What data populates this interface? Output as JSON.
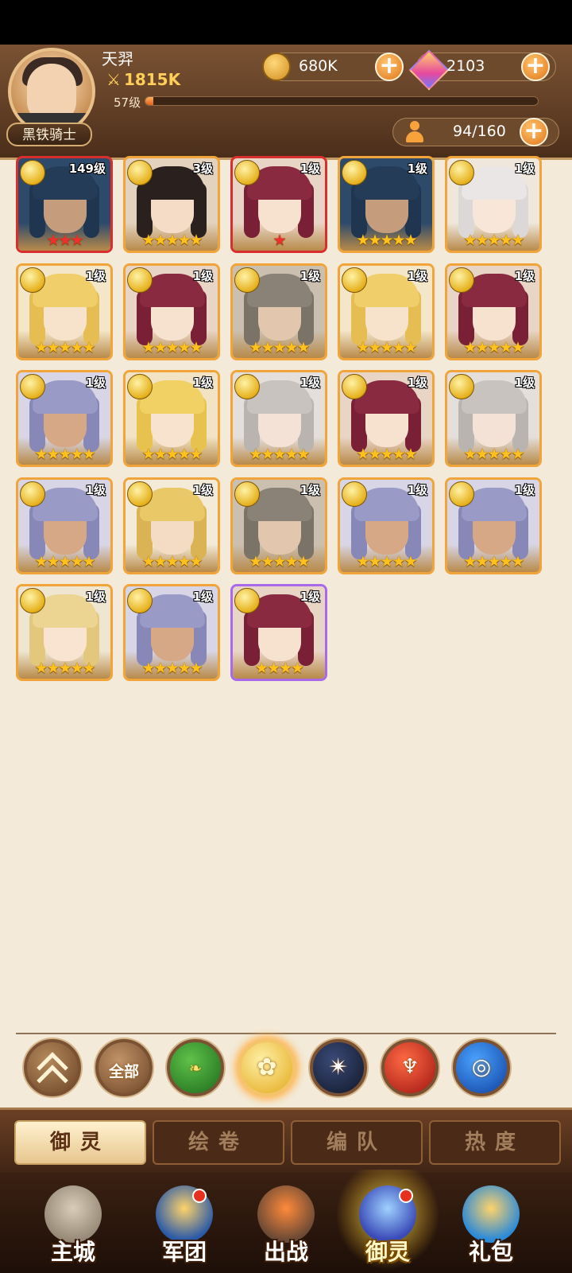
{
  "player": {
    "name": "天羿",
    "power": "1815K",
    "level": "57级",
    "xp_fraction": 0.02,
    "title": "黑铁骑士"
  },
  "resources": {
    "gold": "680K",
    "gems": "2103",
    "roster": "94/160"
  },
  "heroes": [
    {
      "level": "149级",
      "stars": 3,
      "frame": "red",
      "palette": "knight"
    },
    {
      "level": "3级",
      "stars": 5,
      "frame": "gold",
      "palette": "darkhair"
    },
    {
      "level": "1级",
      "stars": 1,
      "frame": "red",
      "palette": "redhair"
    },
    {
      "level": "1级",
      "stars": 5,
      "frame": "gold",
      "palette": "knight"
    },
    {
      "level": "1级",
      "stars": 5,
      "frame": "gold",
      "palette": "silverqueen"
    },
    {
      "level": "1级",
      "stars": 5,
      "frame": "gold",
      "palette": "blonde"
    },
    {
      "level": "1级",
      "stars": 5,
      "frame": "gold",
      "palette": "redhair"
    },
    {
      "level": "1级",
      "stars": 5,
      "frame": "gold",
      "palette": "greyman"
    },
    {
      "level": "1级",
      "stars": 5,
      "frame": "gold",
      "palette": "blonde"
    },
    {
      "level": "1级",
      "stars": 5,
      "frame": "gold",
      "palette": "redhair"
    },
    {
      "level": "1级",
      "stars": 5,
      "frame": "gold",
      "palette": "lavender"
    },
    {
      "level": "1级",
      "stars": 5,
      "frame": "gold",
      "palette": "blondeboy"
    },
    {
      "level": "1级",
      "stars": 5,
      "frame": "gold",
      "palette": "silver"
    },
    {
      "level": "1级",
      "stars": 5,
      "frame": "gold",
      "palette": "redhair"
    },
    {
      "level": "1级",
      "stars": 5,
      "frame": "gold",
      "palette": "silver"
    },
    {
      "level": "1级",
      "stars": 5,
      "frame": "gold",
      "palette": "lavender"
    },
    {
      "level": "1级",
      "stars": 5,
      "frame": "gold",
      "palette": "blondespike"
    },
    {
      "level": "1级",
      "stars": 5,
      "frame": "gold",
      "palette": "greyman"
    },
    {
      "level": "1级",
      "stars": 5,
      "frame": "gold",
      "palette": "lavender"
    },
    {
      "level": "1级",
      "stars": 5,
      "frame": "gold",
      "palette": "lavender"
    },
    {
      "level": "1级",
      "stars": 5,
      "frame": "gold",
      "palette": "crowned"
    },
    {
      "level": "1级",
      "stars": 5,
      "frame": "gold",
      "palette": "lavender"
    },
    {
      "level": "1级",
      "stars": 4,
      "frame": "purple",
      "palette": "redhair"
    }
  ],
  "filters": {
    "collapse_icon": "chevron-up-icon",
    "all_label": "全部",
    "factions": [
      "leaf-faction-icon",
      "rose-faction-icon",
      "star-faction-icon",
      "phoenix-faction-icon",
      "wave-faction-icon"
    ]
  },
  "subtabs": [
    "御灵",
    "绘卷",
    "编队",
    "热度"
  ],
  "nav": [
    {
      "label": "主城",
      "icon": "castle-icon"
    },
    {
      "label": "军团",
      "icon": "fist-shield-icon"
    },
    {
      "label": "出战",
      "icon": "battle-gate-icon"
    },
    {
      "label": "御灵",
      "icon": "crystal-icon"
    },
    {
      "label": "礼包",
      "icon": "gift-shop-icon"
    }
  ],
  "colors": {
    "accent_gold": "#f0a43a",
    "frame_red": "#d92e2e",
    "frame_purple": "#a86ae8",
    "header_brown": "#5b3a22",
    "background": "#f3ead9"
  }
}
